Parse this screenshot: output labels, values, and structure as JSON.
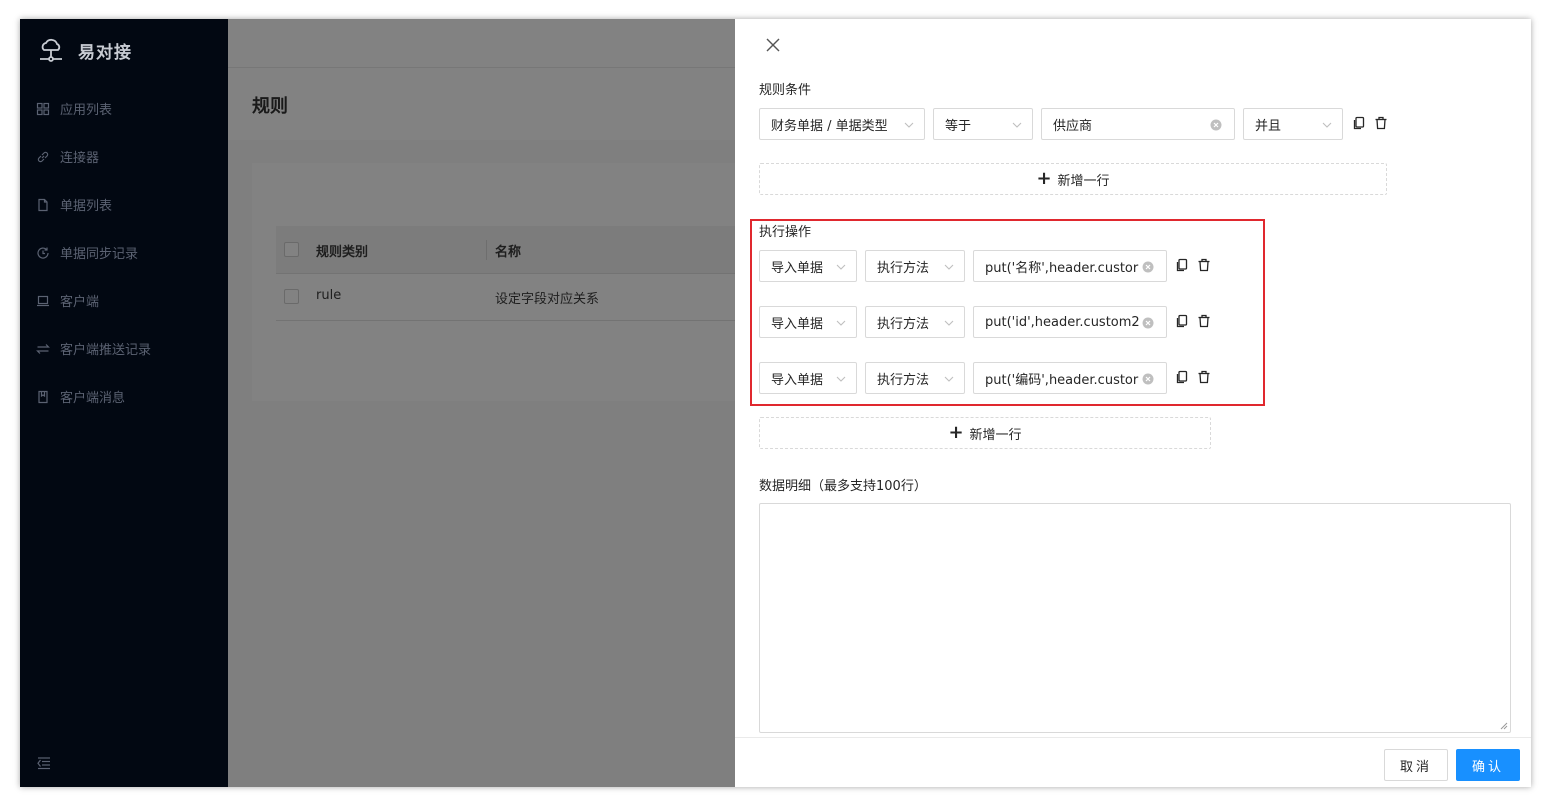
{
  "app": {
    "name": "易对接"
  },
  "sidebar": {
    "items": [
      {
        "label": "应用列表",
        "icon": "grid-icon"
      },
      {
        "label": "连接器",
        "icon": "link-icon"
      },
      {
        "label": "单据列表",
        "icon": "file-icon"
      },
      {
        "label": "单据同步记录",
        "icon": "history-icon"
      },
      {
        "label": "客户端",
        "icon": "laptop-icon"
      },
      {
        "label": "客户端推送记录",
        "icon": "swap-icon"
      },
      {
        "label": "客户端消息",
        "icon": "book-icon"
      }
    ]
  },
  "main": {
    "title": "规则",
    "table": {
      "columns": [
        "规则类别",
        "名称"
      ],
      "rows": [
        {
          "category": "rule",
          "name": "设定字段对应关系"
        }
      ]
    }
  },
  "drawer": {
    "conditions_label": "规则条件",
    "condition": {
      "field": "财务单据 / 单据类型",
      "operator": "等于",
      "value": "供应商",
      "logic": "并且"
    },
    "add_row_label": "新增一行",
    "actions_label": "执行操作",
    "actions": [
      {
        "target": "导入单据",
        "method": "执行方法",
        "value": "put('名称',header.custor"
      },
      {
        "target": "导入单据",
        "method": "执行方法",
        "value": "put('id',header.custom2"
      },
      {
        "target": "导入单据",
        "method": "执行方法",
        "value": "put('编码',header.custor"
      }
    ],
    "details_label": "数据明细（最多支持100行）",
    "details_value": "",
    "cancel_label": "取消",
    "ok_label": "确认"
  },
  "colors": {
    "primary": "#1890ff",
    "highlight": "#e0282e",
    "sidebar_bg": "#020812"
  }
}
